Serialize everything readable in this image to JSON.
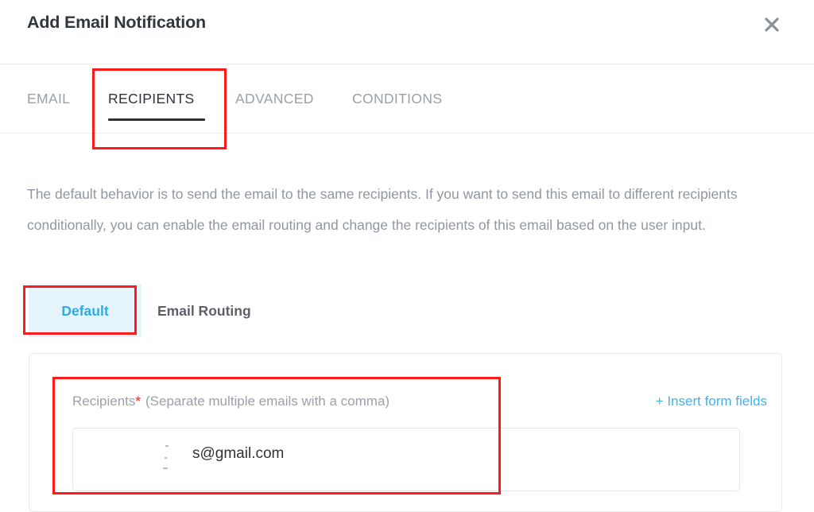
{
  "header": {
    "title": "Add Email Notification",
    "close_icon": "close-icon"
  },
  "tabs": [
    {
      "label": "EMAIL",
      "active": false
    },
    {
      "label": "RECIPIENTS",
      "active": true
    },
    {
      "label": "ADVANCED",
      "active": false
    },
    {
      "label": "CONDITIONS",
      "active": false
    }
  ],
  "description": "The default behavior is to send the email to the same recipients. If you want to send this email to different recipients conditionally, you can enable the email routing and change the recipients of this email based on the user input.",
  "subtabs": [
    {
      "label": "Default",
      "active": true
    },
    {
      "label": "Email Routing",
      "active": false
    }
  ],
  "recipients_field": {
    "label": "Recipients",
    "required_marker": "*",
    "hint": "(Separate multiple emails with a comma)",
    "insert_link": "+ Insert form fields",
    "value": "s@gmail.com",
    "placeholder": ""
  },
  "colors": {
    "accent_blue": "#2bace2",
    "link_blue": "#3cb3ec",
    "subtab_active_bg": "#e6f5fc",
    "annotation_red": "#fb1b1b",
    "required_red": "#f05454",
    "muted_text": "#9aa0a8",
    "title_text": "#32363d"
  }
}
